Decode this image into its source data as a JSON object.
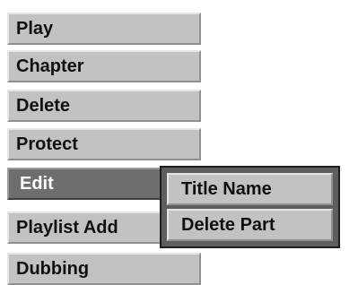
{
  "menu": {
    "items": [
      {
        "label": "Play"
      },
      {
        "label": "Chapter"
      },
      {
        "label": "Delete"
      },
      {
        "label": "Protect"
      },
      {
        "label": "Edit",
        "selected": true
      },
      {
        "label": "Playlist Add"
      },
      {
        "label": "Dubbing"
      }
    ]
  },
  "submenu": {
    "items": [
      {
        "label": "Title Name"
      },
      {
        "label": "Delete Part"
      }
    ]
  },
  "colors": {
    "item_bg": "#c2c2c2",
    "selected_bg": "#6e6e6e",
    "submenu_bg": "#5e5e5e",
    "text": "#111111",
    "selected_text": "#ffffff"
  }
}
